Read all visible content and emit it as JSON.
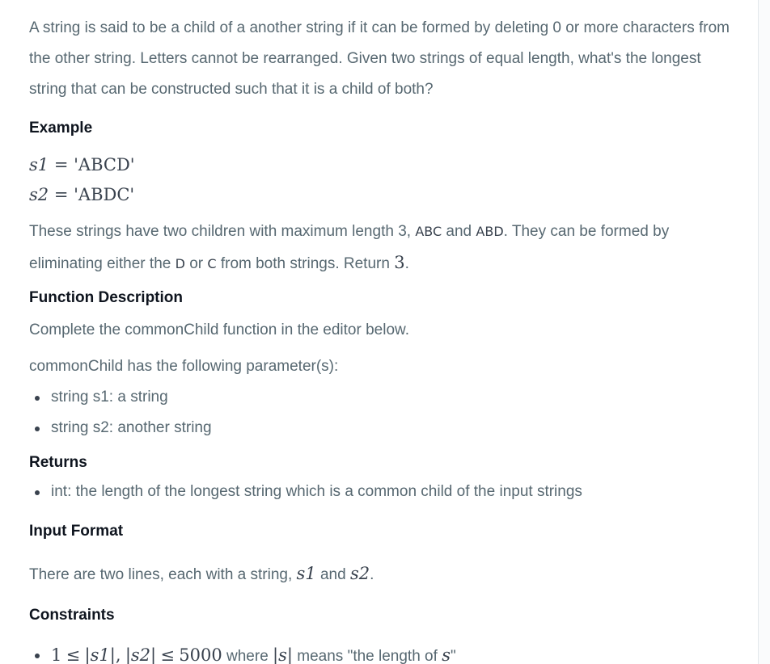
{
  "intro": "A string is said to be a child of a another string if it can be formed by deleting 0 or more characters from the other string. Letters cannot be rearranged. Given two strings of equal length, what's the longest string that can be constructed such that it is a child of both?",
  "example": {
    "heading": "Example",
    "s1_var": "s1",
    "s1_eq": "=",
    "s1_val": "'ABCD'",
    "s2_var": "s2",
    "s2_eq": "=",
    "s2_val": "'ABDC'",
    "explain": {
      "part1": "These strings have two children with maximum length 3, ",
      "abc": "ABC",
      "and": " and ",
      "abd": "ABD",
      "part2": ". They can be formed by eliminating either the ",
      "d": "D",
      "or": " or ",
      "c": "C",
      "part3": " from both strings. Return ",
      "ret": "3",
      "end": "."
    }
  },
  "function_description": {
    "heading": "Function Description",
    "complete": "Complete the commonChild function in the editor below.",
    "params_intro": "commonChild has the following parameter(s):",
    "params": [
      "string s1: a string",
      "string s2: another string"
    ]
  },
  "returns": {
    "heading": "Returns",
    "items": [
      "int: the length of the longest string which is a common child of the input strings"
    ]
  },
  "input_format": {
    "heading": "Input Format",
    "text_before": "There are two lines, each with a string, ",
    "s1": "s1",
    "and": " and ",
    "s2": "s2",
    "end": "."
  },
  "constraints": {
    "heading": "Constraints",
    "item": {
      "one": "1",
      "le": "≤",
      "s1": "|s1|",
      "comma": ",",
      "s2": "|s2|",
      "max": "5000",
      "text_where": " where ",
      "s": "|s|",
      "text_means": " means \"the length of ",
      "s_var": "s",
      "close": "\""
    }
  }
}
